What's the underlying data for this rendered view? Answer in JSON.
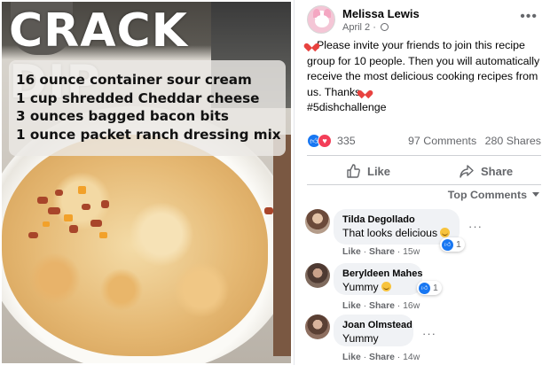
{
  "photo": {
    "title": "CRACK DIP",
    "ingredients": [
      "16 ounce container sour cream",
      "1 cup shredded Cheddar cheese",
      "3 ounces bagged bacon bits",
      "1 ounce packet ranch dressing mix"
    ]
  },
  "post": {
    "author": "Melissa Lewis",
    "date": "April 2 · ",
    "text_main": "Please invite your friends to join this recipe group for 10 people. Then you will automatically receive the most delicious cooking recipes from us. Thanks",
    "hashtag": "#5dishchallenge",
    "more_icon": "more-horizontal-icon",
    "privacy_icon": "globe-icon"
  },
  "stats": {
    "reaction_count": "335",
    "comments": "97 Comments",
    "shares": "280 Shares"
  },
  "actions": {
    "like_label": "Like",
    "share_label": "Share"
  },
  "comments_sort": {
    "label": "Top Comments"
  },
  "comments": [
    {
      "name": "Tilda Degollado",
      "text": "That looks delicious",
      "like": "Like",
      "share": "Share",
      "time": "15w",
      "reactions": "1"
    },
    {
      "name": "Beryldeen Mahes",
      "text": "Yummy",
      "like": "Like",
      "share": "Share",
      "time": "16w",
      "reactions": "1"
    },
    {
      "name": "Joan Olmstead",
      "text": "Yummy",
      "like": "Like",
      "share": "Share",
      "time": "14w"
    }
  ],
  "colors": {
    "accent": "#1877f2",
    "love": "#f33e58",
    "muted": "#65676b",
    "bubble": "#f0f2f5"
  }
}
